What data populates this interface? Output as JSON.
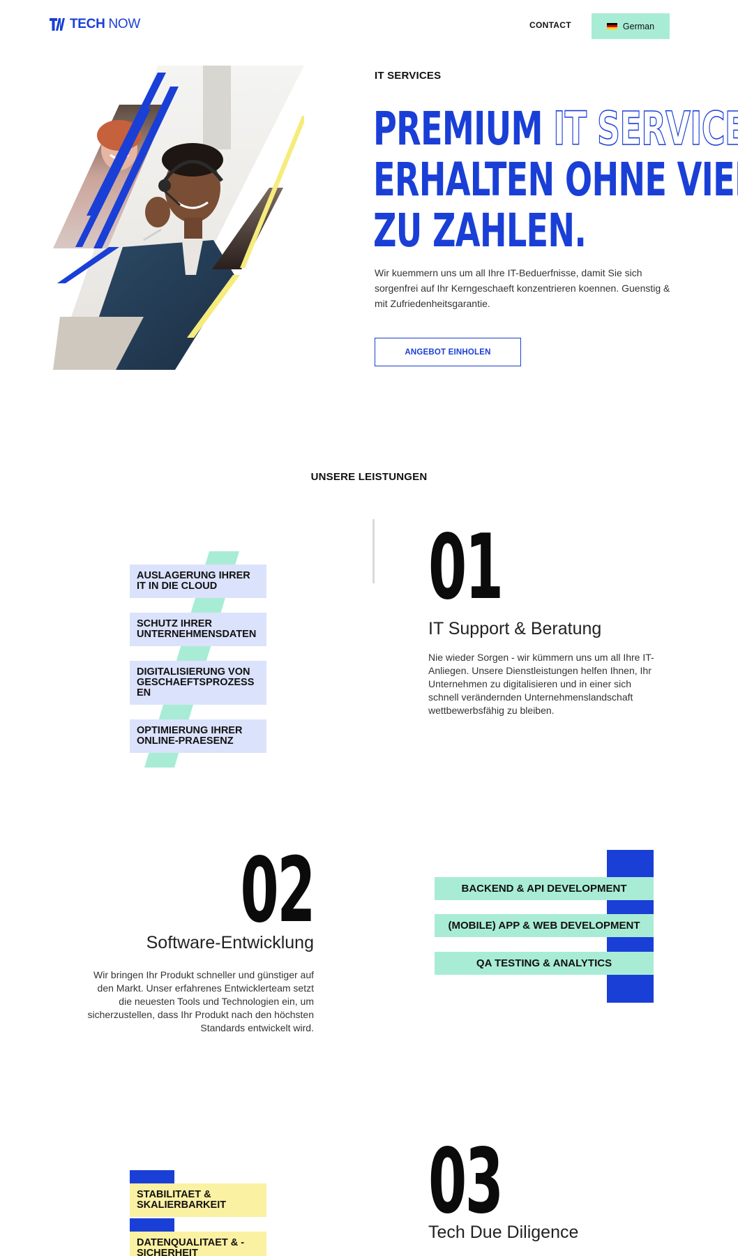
{
  "header": {
    "logo_bold": "TECH",
    "logo_light": "NOW",
    "contact": "CONTACT",
    "language": "German",
    "flag_colors": [
      "#000000",
      "#dd0000",
      "#ffce00"
    ]
  },
  "hero": {
    "eyebrow": "IT SERVICES",
    "headline_word1": "PREMIUM",
    "headline_outline": "IT SERVICES",
    "headline_line2": "ERHALTEN OHNE VIEL",
    "headline_line3": "ZU ZAHLEN.",
    "description": "Wir kuemmern uns um all Ihre IT-Beduerfnisse, damit Sie sich sorgenfrei auf Ihr Kerngeschaeft konzentrieren koennen. Guenstig & mit Zufriedenheitsgarantie.",
    "cta": "ANGEBOT EINHOLEN"
  },
  "services": {
    "section_title": "UNSERE LEISTUNGEN",
    "items": [
      {
        "number": "01",
        "title": "IT Support & Beratung",
        "description": "Nie wieder Sorgen - wir kümmern uns um all Ihre IT-Anliegen. Unsere Dienstleistungen helfen Ihnen, Ihr Unternehmen zu digitalisieren und in einer sich schnell verändernden Unternehmenslandschaft wettbewerbsfähig zu bleiben.",
        "tags": [
          "AUSLAGERUNG IHRER IT IN DIE CLOUD",
          "SCHUTZ IHRER UNTERNEHMENSDATEN",
          "DIGITALISIERUNG VON GESCHAEFTSPROZESS EN",
          "OPTIMIERUNG IHRER ONLINE-PRAESENZ"
        ]
      },
      {
        "number": "02",
        "title": "Software-Entwicklung",
        "description": "Wir bringen Ihr Produkt schneller und günstiger auf den Markt. Unser erfahrenes Entwicklerteam setzt die neuesten Tools und Technologien ein, um sicherzustellen, dass Ihr Produkt nach den höchsten Standards entwickelt wird.",
        "tags": [
          "BACKEND & API DEVELOPMENT",
          "(MOBILE) APP & WEB DEVELOPMENT",
          "QA TESTING & ANALYTICS"
        ]
      },
      {
        "number": "03",
        "title": "Tech Due Diligence",
        "tags": [
          "STABILITAET & SKALIERBARKEIT",
          "DATENQUALITAET & - SICHERHEIT"
        ]
      }
    ]
  },
  "colors": {
    "brand_blue": "#1a3fd6",
    "mint": "#a9ecd6",
    "lavender": "#dbe2fb",
    "yellow": "#fbf1a3"
  }
}
